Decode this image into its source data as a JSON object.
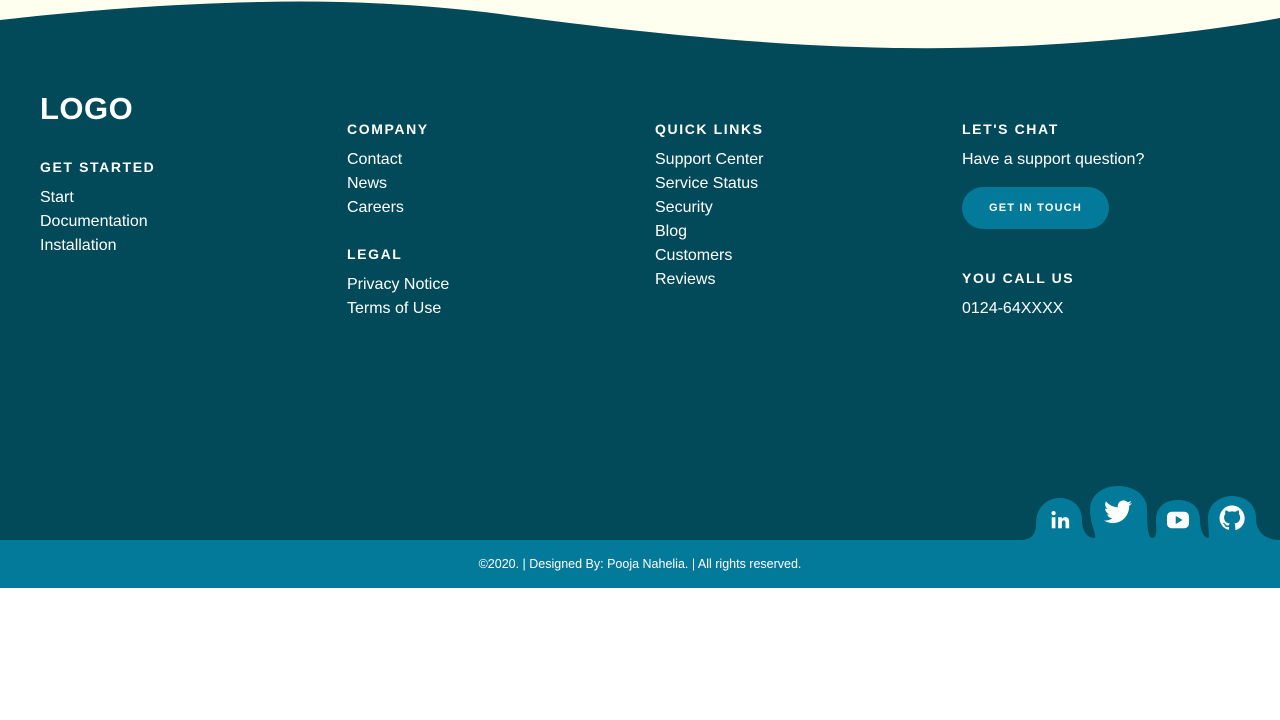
{
  "colors": {
    "wave_background": "#fffff0",
    "footer_background": "#024959",
    "accent": "#047a9a",
    "text": "#ffffff"
  },
  "brand": {
    "logo": "LOGO"
  },
  "get_started": {
    "heading": "GET STARTED",
    "links": [
      "Start",
      "Documentation",
      "Installation"
    ]
  },
  "company": {
    "heading": "COMPANY",
    "links": [
      "Contact",
      "News",
      "Careers"
    ]
  },
  "legal": {
    "heading": "LEGAL",
    "links": [
      "Privacy Notice",
      "Terms of Use"
    ]
  },
  "quick_links": {
    "heading": "QUICK LINKS",
    "links": [
      "Support Center",
      "Service Status",
      "Security",
      "Blog",
      "Customers",
      "Reviews"
    ]
  },
  "chat": {
    "heading": "LET'S CHAT",
    "text": "Have a support question?",
    "button_label": "GET IN TOUCH"
  },
  "call": {
    "heading": "YOU CALL US",
    "phone": "0124-64XXXX"
  },
  "social": [
    {
      "icon": "linkedin-icon"
    },
    {
      "icon": "twitter-icon"
    },
    {
      "icon": "youtube-icon"
    },
    {
      "icon": "github-icon"
    }
  ],
  "bottom_bar": {
    "copyright": "©2020. | Designed By: Pooja Nahelia. | All rights reserved."
  }
}
